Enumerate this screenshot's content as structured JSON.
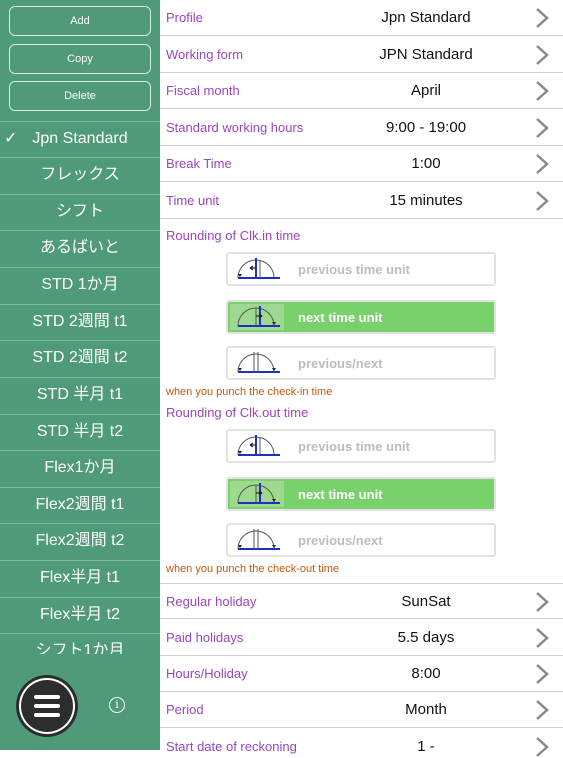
{
  "sidebar": {
    "buttons": {
      "add": "Add",
      "copy": "Copy",
      "delete": "Delete"
    },
    "selected_check": "✓",
    "items": [
      "Jpn Standard",
      "フレックス",
      "シフト",
      "あるばいと",
      "STD 1か月",
      "STD 2週間 t1",
      "STD 2週間 t2",
      "STD 半月 t1",
      "STD 半月 t2",
      "Flex1か月",
      "Flex2週間 t1",
      "Flex2週間 t2",
      "Flex半月 t1",
      "Flex半月 t2",
      "シフト1か月"
    ],
    "info": "i"
  },
  "settings": {
    "profile": {
      "label": "Profile",
      "value": "Jpn Standard"
    },
    "working_form": {
      "label": "Working form",
      "value": "JPN Standard"
    },
    "fiscal_month": {
      "label": "Fiscal month",
      "value": "April"
    },
    "standard_hours": {
      "label": "Standard working hours",
      "value": "9:00 - 19:00"
    },
    "break_time": {
      "label": "Break Time",
      "value": "1:00"
    },
    "time_unit": {
      "label": "Time unit",
      "value": "15 minutes"
    },
    "rounding_in": {
      "title": "Rounding of Clk.in time",
      "options": [
        "previous time unit",
        "next time unit",
        "previous/next"
      ],
      "selected": "next time unit",
      "note": "when you punch the check-in time"
    },
    "rounding_out": {
      "title": "Rounding of Clk.out time",
      "options": [
        "previous time unit",
        "next time unit",
        "previous/next"
      ],
      "selected": "next time unit",
      "note": "when you punch the check-out time"
    },
    "regular_holiday": {
      "label": "Regular holiday",
      "value": "SunSat"
    },
    "paid_holidays": {
      "label": "Paid holidays",
      "value": "5.5 days"
    },
    "hours_holiday": {
      "label": "Hours/Holiday",
      "value": "8:00"
    },
    "period": {
      "label": "Period",
      "value": "Month"
    },
    "start_date": {
      "label": "Start date of reckoning",
      "value": "1 -"
    }
  },
  "colors": {
    "sidebar": "#4f9a79",
    "label": "#9a45bf",
    "note": "#c05a0e",
    "selected_option": "#78d16a"
  }
}
